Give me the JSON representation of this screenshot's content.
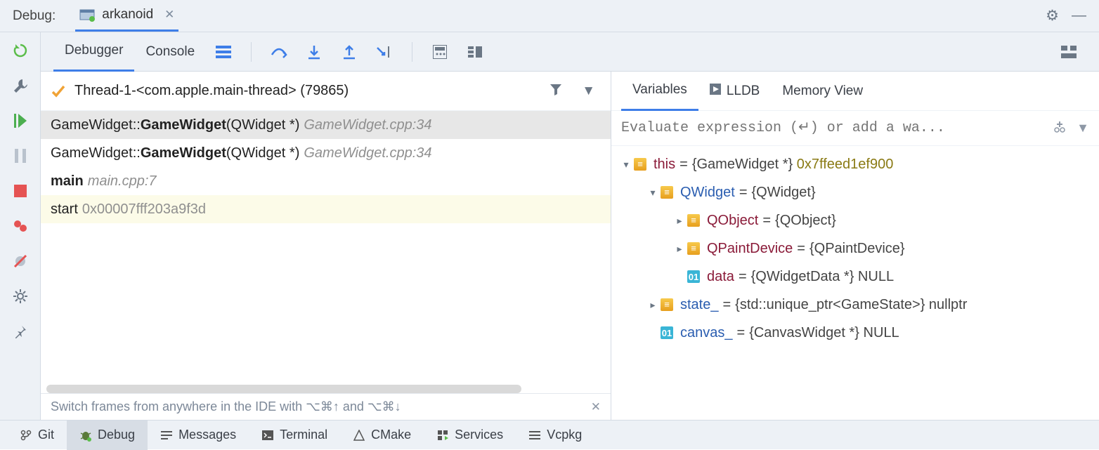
{
  "title": "Debug:",
  "run_config": "arkanoid",
  "debugger_tabs": {
    "debugger": "Debugger",
    "console": "Console"
  },
  "thread": "Thread-1-<com.apple.main-thread> (79865)",
  "frames": [
    {
      "class": "GameWidget::",
      "method": "GameWidget",
      "sig": "(QWidget *)",
      "loc": "GameWidget.cpp:34",
      "selected": true
    },
    {
      "class": "GameWidget::",
      "method": "GameWidget",
      "sig": "(QWidget *)",
      "loc": "GameWidget.cpp:34"
    },
    {
      "class": "",
      "method": "main",
      "sig": "",
      "loc": "main.cpp:7"
    },
    {
      "class": "start",
      "method": "",
      "sig": "",
      "addr": "0x00007fff203a9f3d",
      "last": true
    }
  ],
  "hint": "Switch frames from anywhere in the IDE with ⌥⌘↑ and ⌥⌘↓",
  "vars_tabs": {
    "variables": "Variables",
    "lldb": "LLDB",
    "memory": "Memory View"
  },
  "eval_placeholder": "Evaluate expression (↵) or add a wa...",
  "tree": {
    "this_name": "this",
    "this_val_type": "{GameWidget *}",
    "this_val_ptr": "0x7ffeed1ef900",
    "qwidget_name": "QWidget",
    "qwidget_val": "{QWidget}",
    "qobject_name": "QObject",
    "qobject_val": "{QObject}",
    "qpaint_name": "QPaintDevice",
    "qpaint_val": "{QPaintDevice}",
    "data_name": "data",
    "data_val": "{QWidgetData *} NULL",
    "state_name": "state_",
    "state_val": "{std::unique_ptr<GameState>} nullptr",
    "canvas_name": "canvas_",
    "canvas_val": "{CanvasWidget *} NULL",
    "prim_label": "01"
  },
  "bottom_tabs": {
    "git": "Git",
    "debug": "Debug",
    "messages": "Messages",
    "terminal": "Terminal",
    "cmake": "CMake",
    "services": "Services",
    "vcpkg": "Vcpkg"
  }
}
